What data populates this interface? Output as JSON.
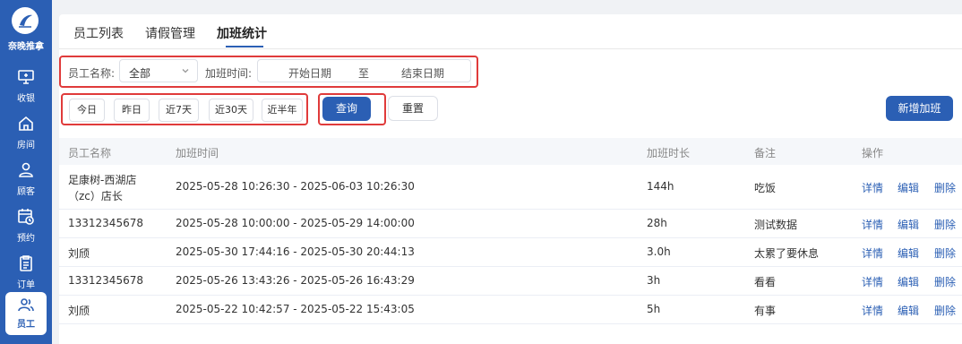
{
  "brand": {
    "name": "奈晚推拿"
  },
  "nav": [
    {
      "label": "收银",
      "icon": "monitor-icon"
    },
    {
      "label": "房间",
      "icon": "home-icon"
    },
    {
      "label": "顾客",
      "icon": "user-icon"
    },
    {
      "label": "预约",
      "icon": "calendar-clock-icon"
    },
    {
      "label": "订单",
      "icon": "clipboard-icon"
    },
    {
      "label": "员工",
      "icon": "users-icon",
      "active": true
    }
  ],
  "tabs": [
    {
      "label": "员工列表"
    },
    {
      "label": "请假管理"
    },
    {
      "label": "加班统计",
      "active": true
    }
  ],
  "filters": {
    "employee_label": "员工名称:",
    "employee_value": "全部",
    "time_label": "加班时间:",
    "start_placeholder": "开始日期",
    "range_sep": "至",
    "end_placeholder": "结束日期"
  },
  "quick_ranges": [
    "今日",
    "昨日",
    "近7天",
    "近30天",
    "近半年"
  ],
  "buttons": {
    "query": "查询",
    "reset": "重置",
    "add": "新增加班"
  },
  "table": {
    "columns": [
      "员工名称",
      "加班时间",
      "加班时长",
      "备注",
      "操作"
    ],
    "actions": [
      "详情",
      "编辑",
      "删除"
    ],
    "rows": [
      {
        "name_line1": "足康树-西湖店",
        "name_line2": "（zc）店长",
        "time": "2025-05-28 10:26:30 - 2025-06-03 10:26:30",
        "duration": "144h",
        "note": "吃饭"
      },
      {
        "name_line1": "13312345678",
        "name_line2": "",
        "time": "2025-05-28 10:00:00 - 2025-05-29 14:00:00",
        "duration": "28h",
        "note": "测试数据"
      },
      {
        "name_line1": "刘颀",
        "name_line2": "",
        "time": "2025-05-30 17:44:16 - 2025-05-30 20:44:13",
        "duration": "3.0h",
        "note": "太累了要休息"
      },
      {
        "name_line1": "13312345678",
        "name_line2": "",
        "time": "2025-05-26 13:43:26 - 2025-05-26 16:43:29",
        "duration": "3h",
        "note": "看看"
      },
      {
        "name_line1": "刘颀",
        "name_line2": "",
        "time": "2025-05-22 10:42:57 - 2025-05-22 15:43:05",
        "duration": "5h",
        "note": "有事"
      }
    ]
  },
  "colors": {
    "primary": "#2b5fb4",
    "highlight": "#e03b3b"
  }
}
